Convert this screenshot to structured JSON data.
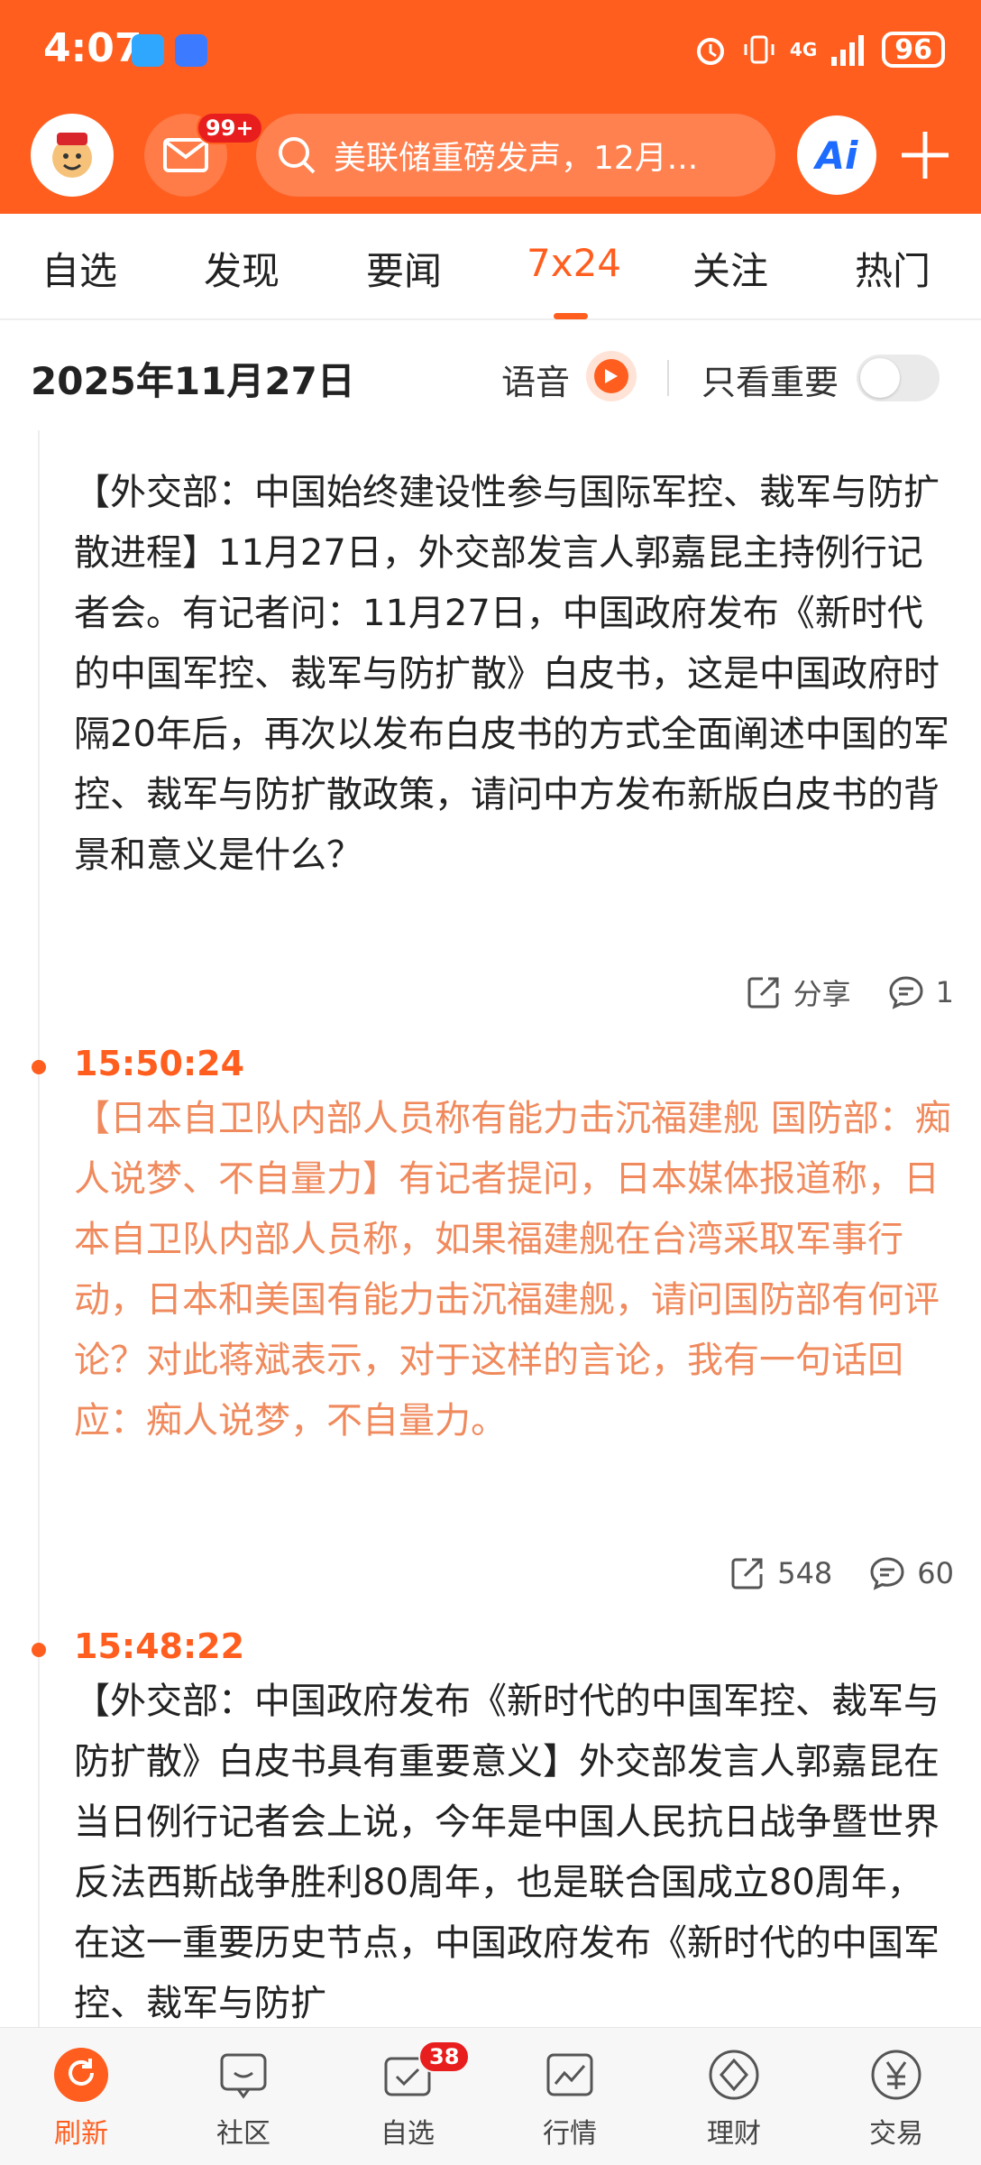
{
  "status_bar": {
    "time": "4:07",
    "battery": "96",
    "network": "4G"
  },
  "header": {
    "mail_badge": "99+",
    "search_placeholder": "美联储重磅发声，12月...",
    "ai_label": "Ai",
    "brand_color": "#FF5E1F"
  },
  "tabs": [
    {
      "label": "自选",
      "active": false
    },
    {
      "label": "发现",
      "active": false
    },
    {
      "label": "要闻",
      "active": false
    },
    {
      "label": "7x24",
      "active": true
    },
    {
      "label": "关注",
      "active": false
    },
    {
      "label": "热门",
      "active": false
    }
  ],
  "date_bar": {
    "date": "2025年11月27日",
    "voice_label": "语音",
    "important_only_label": "只看重要",
    "important_only_on": false
  },
  "feed": [
    {
      "time": "",
      "body": "【外交部：中国始终建设性参与国际军控、裁军与防扩散进程】11月27日，外交部发言人郭嘉昆主持例行记者会。有记者问：11月27日，中国政府发布《新时代的中国军控、裁军与防扩散》白皮书，这是中国政府时隔20年后，再次以发布白皮书的方式全面阐述中国的军控、裁军与防扩散政策，请问中方发布新版白皮书的背景和意义是什么？",
      "important": false,
      "share_label": "分享",
      "comments": "1"
    },
    {
      "time": "15:50:24",
      "body": "【日本自卫队内部人员称有能力击沉福建舰 国防部：痴人说梦、不自量力】有记者提问，日本媒体报道称，日本自卫队内部人员称，如果福建舰在台湾采取军事行动，日本和美国有能力击沉福建舰，请问国防部有何评论？对此蒋斌表示，对于这样的言论，我有一句话回应：痴人说梦，不自量力。",
      "important": true,
      "share_label": "548",
      "comments": "60"
    },
    {
      "time": "15:48:22",
      "body": "【外交部：中国政府发布《新时代的中国军控、裁军与防扩散》白皮书具有重要意义】外交部发言人郭嘉昆在当日例行记者会上说，今年是中国人民抗日战争暨世界反法西斯战争胜利80周年，也是联合国成立80周年，在这一重要历史节点，中国政府发布《新时代的中国军控、裁军与防扩",
      "important": false,
      "share_label": "",
      "comments": ""
    }
  ],
  "bottom_nav": [
    {
      "label": "刷新",
      "icon": "refresh-icon",
      "active": true
    },
    {
      "label": "社区",
      "icon": "community-icon",
      "active": false
    },
    {
      "label": "自选",
      "icon": "watchlist-icon",
      "active": false,
      "badge": "38"
    },
    {
      "label": "行情",
      "icon": "market-icon",
      "active": false
    },
    {
      "label": "理财",
      "icon": "wealth-icon",
      "active": false
    },
    {
      "label": "交易",
      "icon": "trade-icon",
      "active": false
    }
  ]
}
